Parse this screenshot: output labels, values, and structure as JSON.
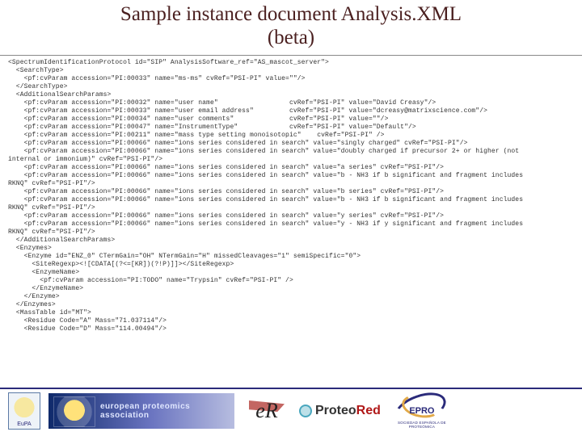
{
  "header": {
    "title_line1": "Sample instance document Analysis.XML",
    "title_line2": "(beta)"
  },
  "xml": {
    "lines": [
      "<SpectrumIdentificationProtocol id=\"SIP\" AnalysisSoftware_ref=\"AS_mascot_server\">",
      "  <SearchType>",
      "    <pf:cvParam accession=\"PI:00033\" name=\"ms-ms\" cvRef=\"PSI-PI\" value=\"\"/>",
      "  </SearchType>",
      "  <AdditionalSearchParams>",
      "    <pf:cvParam accession=\"PI:00032\" name=\"user name\"                  cvRef=\"PSI-PI\" value=\"David Creasy\"/>",
      "    <pf:cvParam accession=\"PI:00033\" name=\"user email address\"         cvRef=\"PSI-PI\" value=\"dcreasy@matrixscience.com\"/>",
      "    <pf:cvParam accession=\"PI:00034\" name=\"user comments\"              cvRef=\"PSI-PI\" value=\"\"/>",
      "    <pf:cvParam accession=\"PI:00047\" name=\"InstrumentType\"             cvRef=\"PSI-PI\" value=\"Default\"/>",
      "    <pf:cvParam accession=\"PI:00211\" name=\"mass type setting monoisotopic\"    cvRef=\"PSI-PI\" />",
      "    <pf:cvParam accession=\"PI:00066\" name=\"ions series considered in search\" value=\"singly charged\" cvRef=\"PSI-PI\"/>",
      "    <pf:cvParam accession=\"PI:00066\" name=\"ions series considered in search\" value=\"doubly charged if precursor 2+ or higher (not",
      "internal or immonium)\" cvRef=\"PSI-PI\"/>",
      "    <pf:cvParam accession=\"PI:00066\" name=\"ions series considered in search\" value=\"a series\" cvRef=\"PSI-PI\"/>",
      "    <pf:cvParam accession=\"PI:00066\" name=\"ions series considered in search\" value=\"b - NH3 if b significant and fragment includes",
      "RKNQ\" cvRef=\"PSI-PI\"/>",
      "    <pf:cvParam accession=\"PI:00066\" name=\"ions series considered in search\" value=\"b series\" cvRef=\"PSI-PI\"/>",
      "    <pf:cvParam accession=\"PI:00066\" name=\"ions series considered in search\" value=\"b - NH3 if b significant and fragment includes",
      "RKNQ\" cvRef=\"PSI-PI\"/>",
      "    <pf:cvParam accession=\"PI:00066\" name=\"ions series considered in search\" value=\"y series\" cvRef=\"PSI-PI\"/>",
      "    <pf:cvParam accession=\"PI:00066\" name=\"ions series considered in search\" value=\"y - NH3 if y significant and fragment includes",
      "RKNQ\" cvRef=\"PSI-PI\"/>",
      "  </AdditionalSearchParams>",
      "  <Enzymes>",
      "    <Enzyme id=\"ENZ_0\" CTermGain=\"OH\" NTermGain=\"H\" missedCleavages=\"1\" semiSpecific=\"0\">",
      "      <SiteRegexp><![CDATA[(?<=[KR])(?!P)]]></SiteRegexp>",
      "      <EnzymeName>",
      "        <pf:cvParam accession=\"PI:TODO\" name=\"Trypsin\" cvRef=\"PSI-PI\" />",
      "      </EnzymeName>",
      "    </Enzyme>",
      "  </Enzymes>",
      "  <MassTable id=\"MT\">",
      "    <Residue Code=\"A\" Mass=\"71.037114\"/>",
      "    <Residue Code=\"D\" Mass=\"114.00494\"/>"
    ]
  },
  "footer": {
    "eupa": "EuPA",
    "banner": "european proteomics association",
    "proteored_pre": "Proteo",
    "proteored_red": "Red",
    "epro_label": "EPRO",
    "epro_small": "SOCIEDAD ESPAÑOLA DE PROTEÓMICA"
  }
}
